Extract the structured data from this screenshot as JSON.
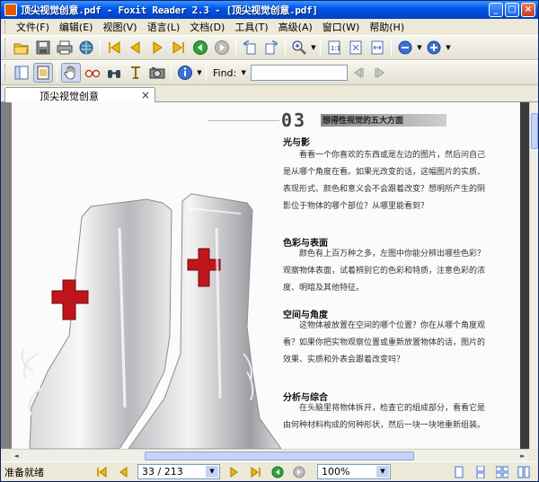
{
  "window": {
    "title": "顶尖视觉创意.pdf - Foxit Reader 2.3 - [顶尖视觉创意.pdf]",
    "buttons": [
      "_",
      "□",
      "×"
    ]
  },
  "menu": {
    "items": [
      "文件(F)",
      "编辑(E)",
      "视图(V)",
      "语言(L)",
      "文档(D)",
      "工具(T)",
      "高级(A)",
      "窗口(W)",
      "帮助(H)"
    ]
  },
  "toolbar2": {
    "find_label": "Find:",
    "find_value": ""
  },
  "tab": {
    "label": "顶尖视觉创意",
    "close": "×"
  },
  "page": {
    "header_number": "03",
    "header_title": "想得性视觉的五大方面",
    "sections": [
      {
        "title": "光与影",
        "text": "看看一个你喜欢的东西或是左边的图片，然后问自己是从哪个角度在看。如果光改变的话，这幅图片的实质、表现形式、颜色和意义会不会跟着改变？想明所产生的阴影位于物体的哪个部位？从哪里能看到？"
      },
      {
        "title": "色彩与表面",
        "text": "颜色有上百万种之多，左图中你能分辨出哪些色彩？观察物体表面，试着辨别它的色彩和特质，注意色彩的浓度、明暗及其他特征。"
      },
      {
        "title": "空间与角度",
        "text": "这物体被放置在空间的哪个位置？你在从哪个角度观看？如果你把实物观察位置或重新放置物体的话，图片的效果、实质和外表会跟着改变吗？"
      },
      {
        "title": "分析与综合",
        "text": "在头脑里将物体拆开，检查它的组成部分，看看它是由何种材料构成的何种形状，然后一块一块地重新组装。"
      }
    ]
  },
  "status": {
    "text": "准备就绪",
    "page_indicator": "33 / 213",
    "zoom": "100%"
  },
  "colors": {
    "titlebar": "#0058ee",
    "chrome": "#ece9d8",
    "cross": "#c0161b"
  }
}
